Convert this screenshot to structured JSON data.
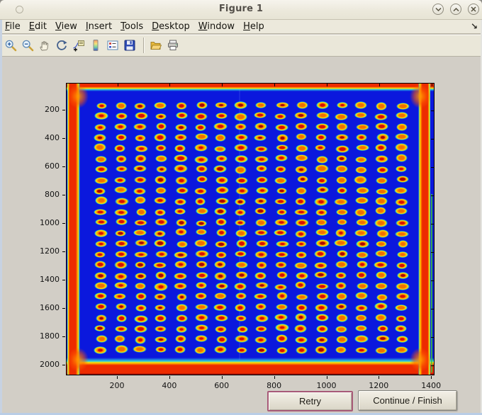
{
  "window": {
    "title": "Figure 1",
    "controls": [
      {
        "name": "shade-window",
        "glyph": "chevron-down"
      },
      {
        "name": "unshade-window",
        "glyph": "chevron-up"
      },
      {
        "name": "close-window",
        "glyph": "x"
      }
    ]
  },
  "menu": {
    "items": [
      "File",
      "Edit",
      "View",
      "Insert",
      "Tools",
      "Desktop",
      "Window",
      "Help"
    ],
    "dock_glyph": "↘"
  },
  "toolbar": {
    "buttons": [
      "zoom-in",
      "zoom-out",
      "pan",
      "rotate-3d",
      "data-cursor",
      "insert-colorbar",
      "insert-legend",
      "save-figure",
      "open-file",
      "print-figure"
    ]
  },
  "actions": {
    "retry": "Retry",
    "continue_finish": "Continue / Finish"
  },
  "chart_data": {
    "type": "heatmap",
    "title": "",
    "description": "Jet-colormap intensity image of a spotted assay plate: 24 rows x 16 columns of elliptical spots with red-orange cores, yellow bodies and cyan halos on a deep blue background; saturated red bands run along all four plate edges with orange corner blobs.",
    "x_axis": {
      "ticks": [
        200,
        400,
        600,
        800,
        1000,
        1200,
        1400
      ],
      "lim": [
        5,
        1413
      ]
    },
    "y_axis": {
      "ticks": [
        200,
        400,
        600,
        800,
        1000,
        1200,
        1400,
        1600,
        1800,
        2000
      ],
      "lim": [
        10,
        2075
      ],
      "direction": "down"
    },
    "grid": {
      "rows": 24,
      "cols": 16,
      "x0_frac": 0.0923,
      "x1_frac": 0.9096,
      "y0_frac": 0.0751,
      "y1_frac": 0.9104
    },
    "colors": {
      "background": "#0b18dd",
      "spot_core": "#d81000",
      "spot_core_dark": "#a80800",
      "spot_core_orange": "#ee7200",
      "spot_mid": "#ff7a00",
      "spot_ring": "#ffb000",
      "spot_ring_outer": "#ffe000",
      "spot_halo": "#22d6c8",
      "edge_red": "#ed2b00",
      "edge_orange": "#ff9000",
      "edge_yellow": "#ffe000",
      "edge_cyan": "#2fd0e0",
      "edge_dark": "#7a0606",
      "edge_green": "#3ec23e"
    }
  },
  "ui_colors": {
    "titlebar": "#ece9dc",
    "toolbar": "#eae7d9",
    "figure_background": "#d2cec6",
    "focus_ring": "#a75a78"
  }
}
